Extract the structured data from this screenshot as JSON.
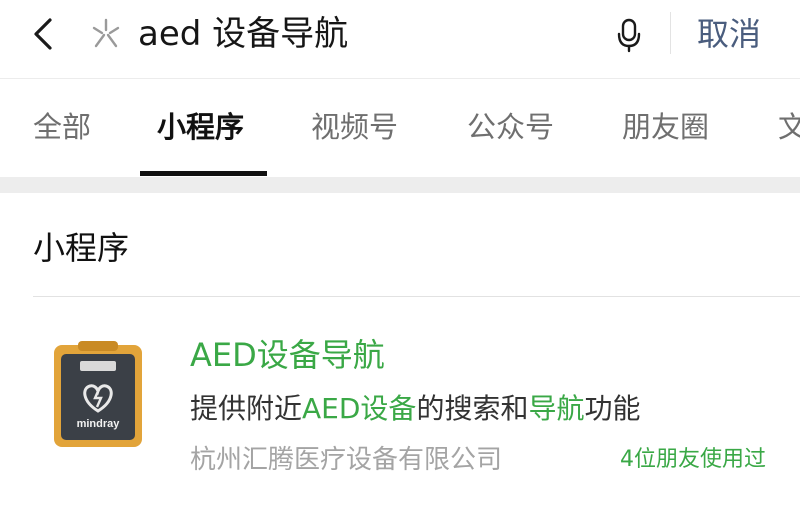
{
  "search": {
    "query": "aed 设备导航",
    "cancel_label": "取消"
  },
  "tabs": [
    {
      "label": "全部"
    },
    {
      "label": "小程序"
    },
    {
      "label": "视频号"
    },
    {
      "label": "公众号"
    },
    {
      "label": "朋友圈"
    },
    {
      "label": "文"
    }
  ],
  "active_tab": "小程序",
  "section": {
    "title": "小程序"
  },
  "result": {
    "title": "AED设备导航",
    "description_parts": [
      "提供附近",
      "AED设备",
      "的搜索和",
      "导航",
      "功能"
    ],
    "company": "杭州汇腾医疗设备有限公司",
    "friends_used": "4位朋友使用过",
    "thumbnail_brand": "mindray"
  },
  "icons": {
    "back": "chevron-left-icon",
    "search_logo": "wechat-search-icon",
    "mic": "microphone-icon"
  },
  "colors": {
    "accent_green": "#3aa846",
    "cancel_blue": "#4a5d7e",
    "divider_gray": "#ededed"
  }
}
